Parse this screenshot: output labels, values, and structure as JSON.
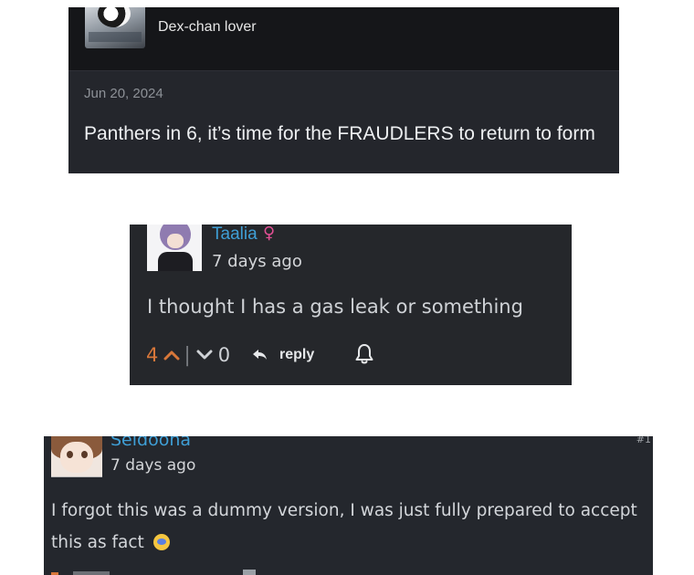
{
  "card1": {
    "username": "Dex-chan lover",
    "date": "Jun 20, 2024",
    "body": "Panthers in 6, it’s time for the FRAUDLERS to return to form"
  },
  "card2": {
    "username": "Taalia",
    "gender_symbol": "♀",
    "time": "7 days ago",
    "text": "I thought I has a gas leak or something",
    "upvotes": "4",
    "separator": "|",
    "downvotes": "0",
    "reply_label": "reply",
    "icons": [
      "avatar",
      "female-icon",
      "upvote-arrow-icon",
      "downvote-arrow-icon",
      "reply-arrow-icon",
      "bell-icon"
    ],
    "colors": {
      "username": "#3f9fd6",
      "upvote": "#d7773a",
      "gender": "#e24f94"
    }
  },
  "card3": {
    "username": "Seldoona",
    "badge": "#1",
    "time": "7 days ago",
    "text": "I forgot this was a dummy version, I was just fully prepared to accept this as fact",
    "emoji": "crying-face"
  }
}
